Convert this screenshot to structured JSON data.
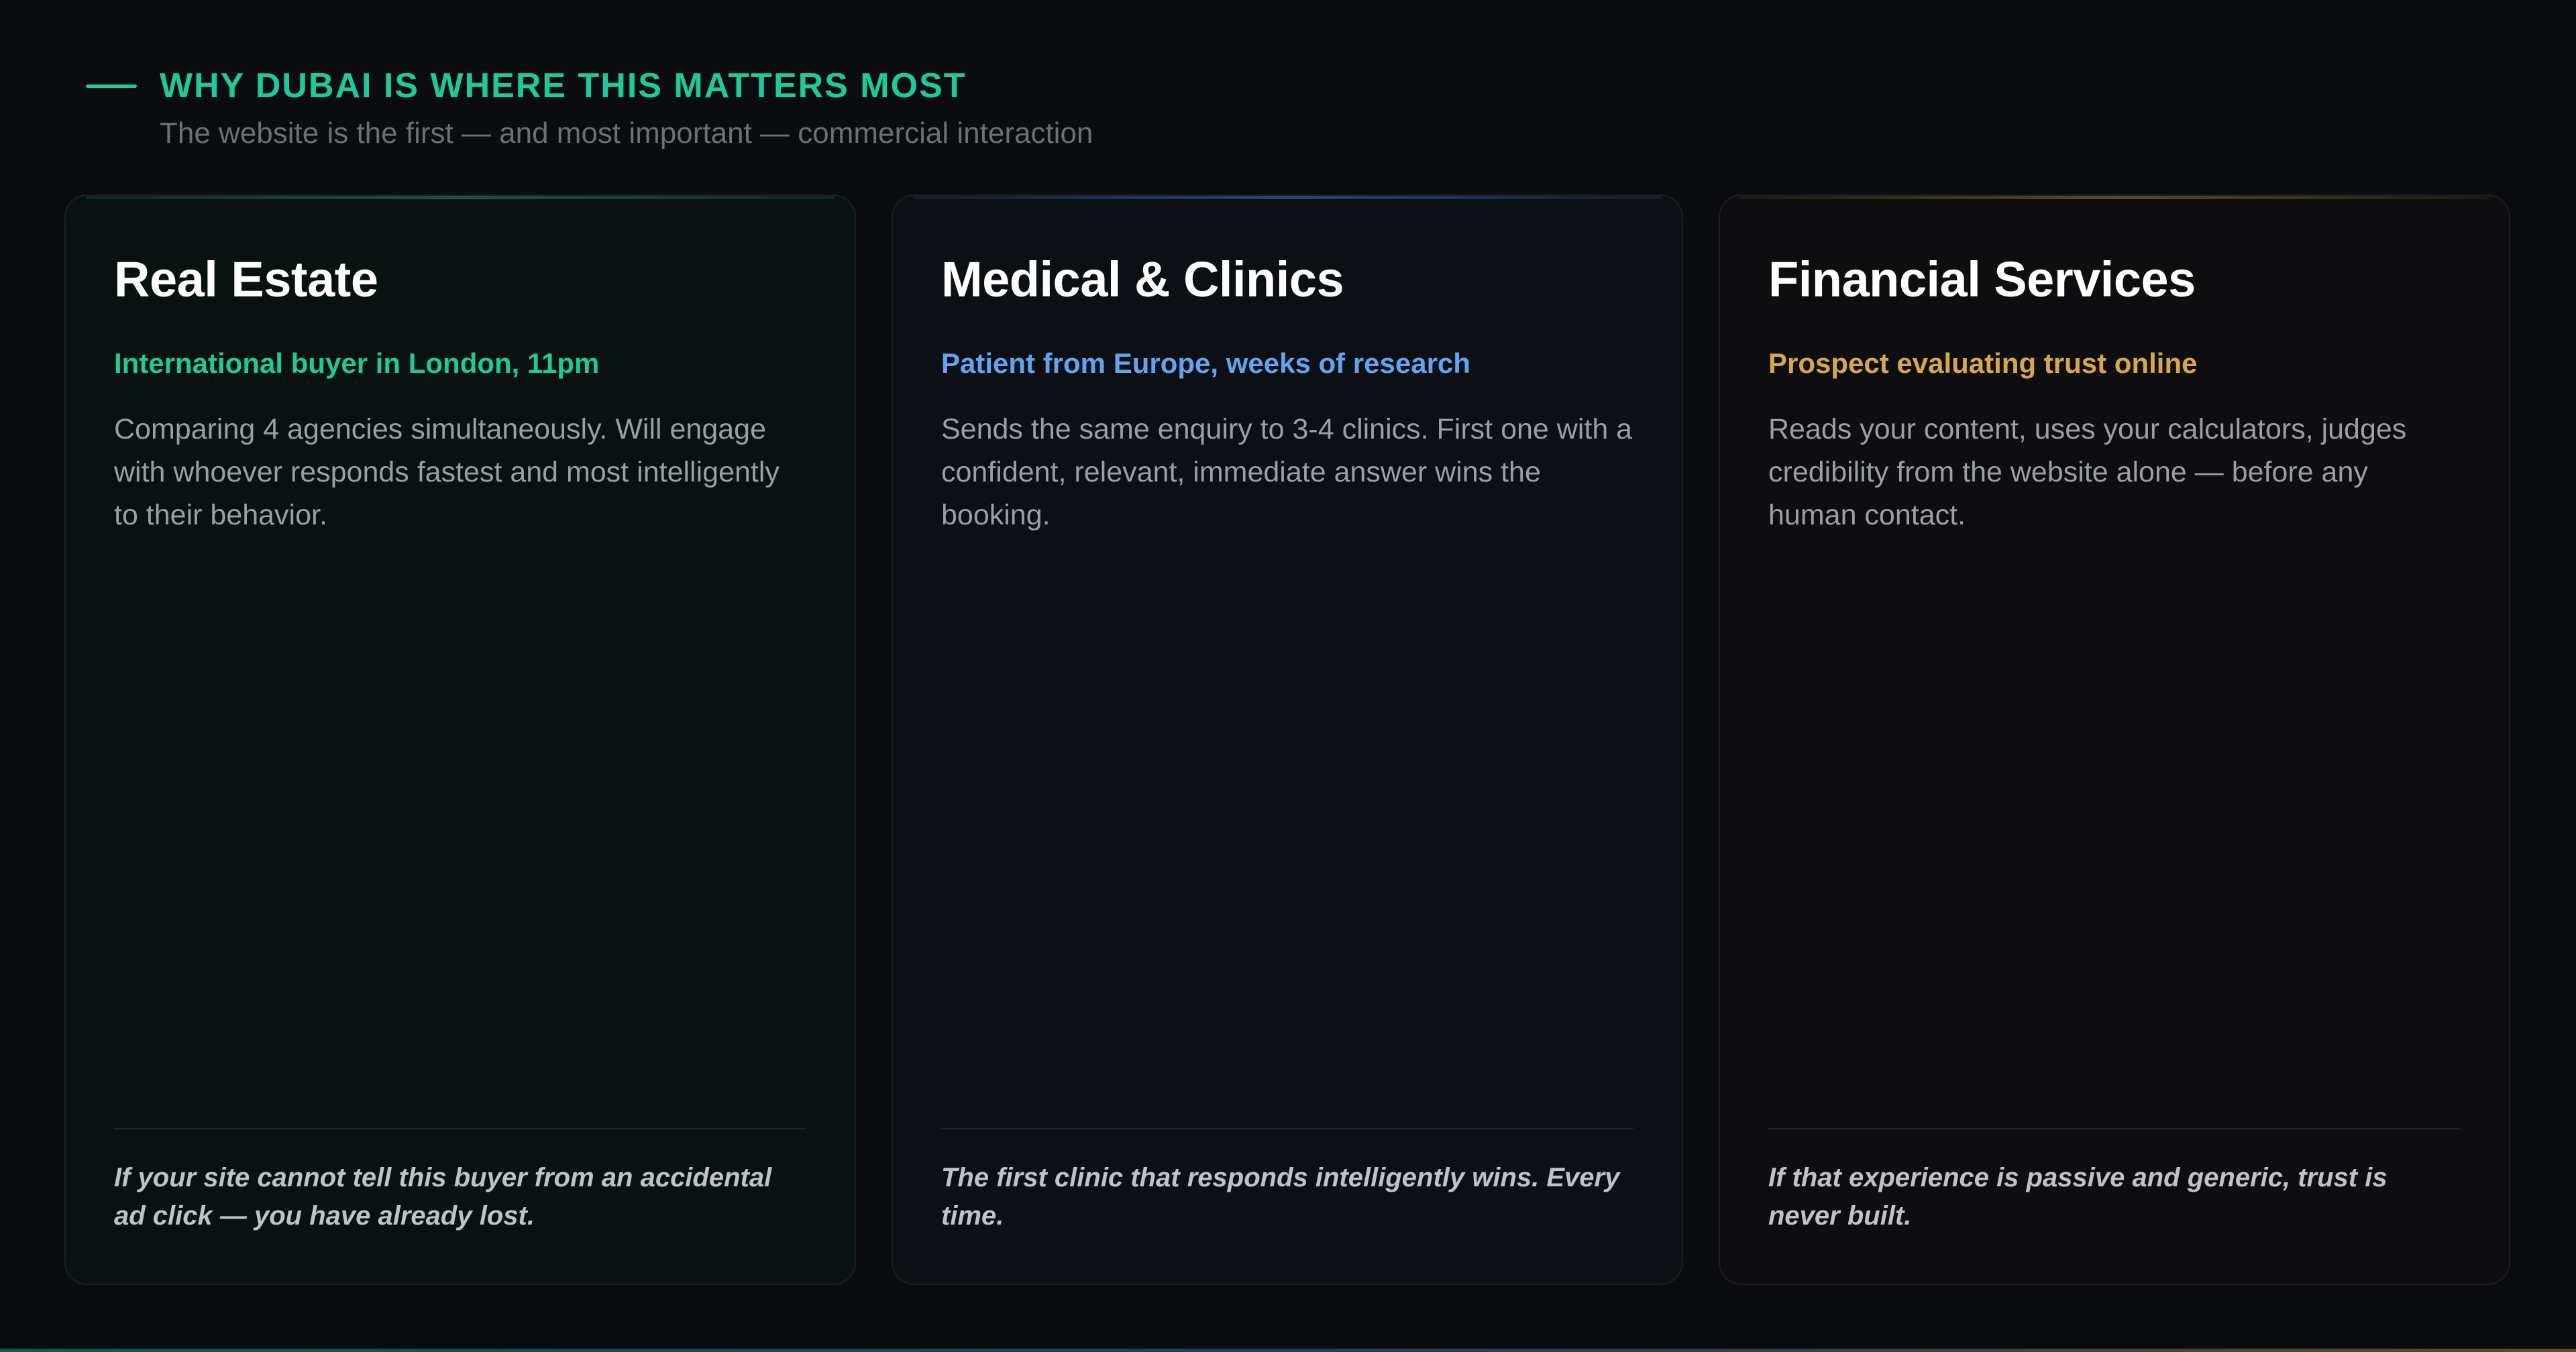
{
  "header": {
    "eyebrow": "WHY DUBAI IS WHERE THIS MATTERS MOST",
    "subtitle": "The website is the first — and most important — commercial interaction"
  },
  "cards": [
    {
      "title": "Real Estate",
      "kicker": "International buyer in London, 11pm",
      "body": "Comparing 4 agencies simultaneously. Will engage with whoever responds fastest and most intelligently to their behavior.",
      "footer": "If your site cannot tell this buyer from an accidental ad click — you have already lost."
    },
    {
      "title": "Medical & Clinics",
      "kicker": "Patient from Europe, weeks of research",
      "body": "Sends the same enquiry to 3-4 clinics. First one with a confident, relevant, immediate answer wins the booking.",
      "footer": "The first clinic that responds intelligently wins. Every time."
    },
    {
      "title": "Financial Services",
      "kicker": "Prospect evaluating trust online",
      "body": "Reads your content, uses your calculators, judges credibility from the website alone — before any human contact.",
      "footer": "If that experience is passive and generic, trust is never built."
    }
  ],
  "colors": {
    "background": "#0b0c0f",
    "accent_green": "#1ec99a",
    "accent_blue": "#62a4f2",
    "accent_gold": "#d7a84a"
  }
}
